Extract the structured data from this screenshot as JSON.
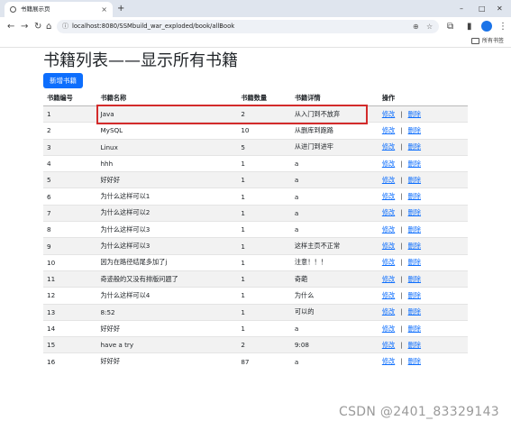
{
  "browser": {
    "tab_title": "书籍展示页",
    "tab_close": "×",
    "new_tab": "+",
    "url": "localhost:8080/SSMbuild_war_exploded/book/allBook",
    "bookmark_label": "所有书签",
    "window_controls": {
      "minimize": "–",
      "maximize": "□",
      "close": "✕"
    },
    "icons": {
      "back": "←",
      "forward": "→",
      "reload": "↻",
      "home": "⌂",
      "lock": "ⓘ",
      "zoom": "⊕",
      "star": "☆",
      "extensions": "⧉",
      "sidebar": "▮",
      "menu": "⋮",
      "profile": "●"
    }
  },
  "page": {
    "title": "书籍列表——显示所有书籍",
    "add_button": "新增书籍",
    "columns": [
      "书籍编号",
      "书籍名称",
      "书籍数量",
      "书籍详情",
      "操作"
    ],
    "edit_label": "修改",
    "separator": "|",
    "delete_label": "删除",
    "rows": [
      {
        "id": "1",
        "name": "Java",
        "count": "2",
        "detail": "从入门到不放弃"
      },
      {
        "id": "2",
        "name": "MySQL",
        "count": "10",
        "detail": "从删库到跑路"
      },
      {
        "id": "3",
        "name": "Linux",
        "count": "5",
        "detail": "从进门到进牢"
      },
      {
        "id": "4",
        "name": "hhh",
        "count": "1",
        "detail": "a"
      },
      {
        "id": "5",
        "name": "好好好",
        "count": "1",
        "detail": "a"
      },
      {
        "id": "6",
        "name": "为什么这样可以1",
        "count": "1",
        "detail": "a"
      },
      {
        "id": "7",
        "name": "为什么这样可以2",
        "count": "1",
        "detail": "a"
      },
      {
        "id": "8",
        "name": "为什么这样可以3",
        "count": "1",
        "detail": "a"
      },
      {
        "id": "9",
        "name": "为什么这样可以3",
        "count": "1",
        "detail": "这样主页不正常"
      },
      {
        "id": "10",
        "name": "因为在路径结尾多加了j",
        "count": "1",
        "detail": "注意！！！"
      },
      {
        "id": "11",
        "name": "奇迹般的又没有排版问题了",
        "count": "1",
        "detail": "奇葩"
      },
      {
        "id": "12",
        "name": "为什么这样可以4",
        "count": "1",
        "detail": "为什么"
      },
      {
        "id": "13",
        "name": "8:52",
        "count": "1",
        "detail": "可以的"
      },
      {
        "id": "14",
        "name": "好好好",
        "count": "1",
        "detail": "a"
      },
      {
        "id": "15",
        "name": "have a try",
        "count": "2",
        "detail": "9:08"
      },
      {
        "id": "16",
        "name": "好好好",
        "count": "87",
        "detail": "a"
      }
    ]
  },
  "watermark": "CSDN @2401_83329143",
  "colors": {
    "accent": "#0d6efd",
    "highlight": "#d32b2b",
    "stripe": "#f2f2f2"
  }
}
